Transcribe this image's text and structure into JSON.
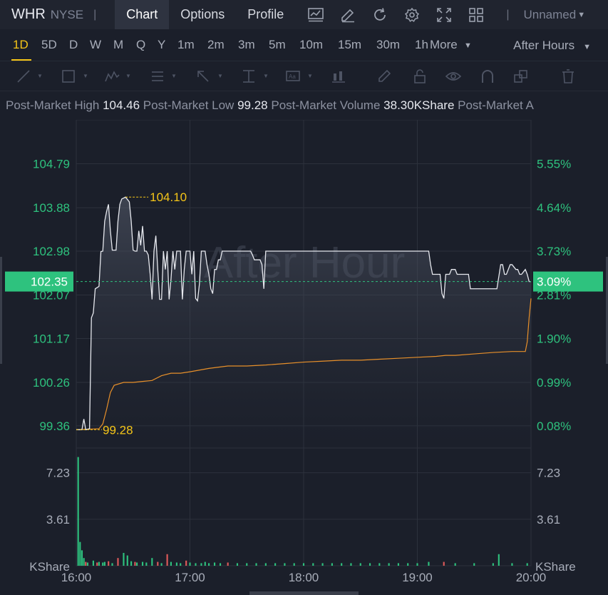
{
  "header": {
    "ticker": "WHR",
    "exchange": "NYSE",
    "separator": "|",
    "tabs": [
      "Chart",
      "Options",
      "Profile"
    ],
    "layout_name": "Unnamed"
  },
  "periods": {
    "items": [
      "1D",
      "5D",
      "D",
      "W",
      "M",
      "Q",
      "Y",
      "1m",
      "2m",
      "3m",
      "5m",
      "10m",
      "15m",
      "30m",
      "1h"
    ],
    "more": "More",
    "session": "After Hours"
  },
  "info": {
    "high_label": "Post-Market High",
    "high_value": "104.46",
    "low_label": "Post-Market Low",
    "low_value": "99.28",
    "volume_label": "Post-Market Volume",
    "volume_value": "38.30KShare",
    "extra_label": "Post-Market A"
  },
  "colors": {
    "up": "#2ec27e",
    "down": "#e05a5a",
    "avg_line": "#e8902a",
    "price_line": "#e6e8ee",
    "highlight": "#f5c518"
  },
  "chart_data": {
    "type": "line",
    "watermark": "After Hour",
    "x_ticks": [
      "16:00",
      "17:00",
      "18:00",
      "19:00",
      "20:00"
    ],
    "y_ticks": [
      "104.79",
      "103.88",
      "102.98",
      "102.07",
      "101.17",
      "100.26",
      "99.36"
    ],
    "pct_ticks": [
      "5.55%",
      "4.64%",
      "3.73%",
      "2.81%",
      "1.90%",
      "0.99%",
      "0.08%"
    ],
    "ylim": [
      98.9,
      105.7
    ],
    "current_price": "102.35",
    "current_pct": "3.09%",
    "max_label": "104.10",
    "min_label": "99.28",
    "volume_ticks": [
      "7.23",
      "3.61"
    ],
    "volume_unit": "KShare",
    "volume_ylim": [
      0,
      9.15
    ],
    "price_series": [
      [
        0,
        99.28
      ],
      [
        3,
        99.28
      ],
      [
        4,
        99.5
      ],
      [
        5,
        99.28
      ],
      [
        7,
        99.3
      ],
      [
        8,
        101.6
      ],
      [
        9,
        101.7
      ],
      [
        10,
        102.2
      ],
      [
        12,
        102.25
      ],
      [
        13,
        102.97
      ],
      [
        14,
        102.98
      ],
      [
        15,
        103.6
      ],
      [
        16,
        103.8
      ],
      [
        17,
        103.95
      ],
      [
        18,
        103.4
      ],
      [
        19,
        103.0
      ],
      [
        21,
        103.0
      ],
      [
        22,
        103.6
      ],
      [
        23,
        103.95
      ],
      [
        24,
        104.06
      ],
      [
        26,
        104.1
      ],
      [
        28,
        104.0
      ],
      [
        29,
        103.6
      ],
      [
        30,
        103.0
      ],
      [
        31,
        102.98
      ],
      [
        32,
        102.98
      ],
      [
        33,
        103.4
      ],
      [
        34,
        103.1
      ],
      [
        35,
        103.5
      ],
      [
        36,
        102.98
      ],
      [
        37,
        102.98
      ],
      [
        38,
        102.9
      ],
      [
        39,
        102.5
      ],
      [
        40,
        101.98
      ],
      [
        41,
        102.98
      ],
      [
        42,
        103.3
      ],
      [
        43,
        102.6
      ],
      [
        44,
        101.98
      ],
      [
        45,
        101.98
      ],
      [
        46,
        102.98
      ],
      [
        47,
        102.6
      ],
      [
        48,
        102.98
      ],
      [
        49,
        101.98
      ],
      [
        50,
        102.4
      ],
      [
        51,
        102.98
      ],
      [
        52,
        102.6
      ],
      [
        53,
        102.98
      ],
      [
        55,
        102.98
      ],
      [
        56,
        101.98
      ],
      [
        57,
        102.6
      ],
      [
        58,
        102.98
      ],
      [
        59,
        102.98
      ],
      [
        60,
        102.98
      ],
      [
        61,
        102.5
      ],
      [
        62,
        102.98
      ],
      [
        63,
        102.0
      ],
      [
        64,
        101.95
      ],
      [
        65,
        102.3
      ],
      [
        66,
        102.98
      ],
      [
        67,
        102.98
      ],
      [
        68,
        102.98
      ],
      [
        69,
        102.7
      ],
      [
        70,
        102.5
      ],
      [
        71,
        102.2
      ],
      [
        72,
        102.1
      ],
      [
        73,
        102.6
      ],
      [
        74,
        102.6
      ],
      [
        75,
        102.8
      ],
      [
        76,
        102.8
      ],
      [
        77,
        102.98
      ],
      [
        79,
        102.98
      ],
      [
        80,
        102.98
      ],
      [
        81,
        102.98
      ],
      [
        83,
        102.98
      ],
      [
        85,
        102.98
      ],
      [
        89,
        102.98
      ],
      [
        90,
        102.98
      ],
      [
        92,
        102.98
      ],
      [
        93,
        102.9
      ],
      [
        94,
        102.8
      ],
      [
        95,
        102.8
      ],
      [
        97,
        102.8
      ],
      [
        98,
        102.7
      ],
      [
        99,
        102.2
      ],
      [
        100,
        102.98
      ],
      [
        102,
        102.98
      ],
      [
        105,
        102.98
      ],
      [
        108,
        102.98
      ],
      [
        110,
        102.98
      ],
      [
        115,
        102.98
      ],
      [
        120,
        102.98
      ],
      [
        125,
        102.98
      ],
      [
        130,
        102.98
      ],
      [
        135,
        102.98
      ],
      [
        140,
        102.98
      ],
      [
        145,
        102.98
      ],
      [
        150,
        102.98
      ],
      [
        155,
        102.98
      ],
      [
        160,
        102.98
      ],
      [
        165,
        102.98
      ],
      [
        170,
        102.98
      ],
      [
        175,
        102.98
      ],
      [
        180,
        102.98
      ],
      [
        185,
        102.98
      ],
      [
        186,
        102.98
      ],
      [
        187,
        102.7
      ],
      [
        188,
        102.5
      ],
      [
        190,
        102.5
      ],
      [
        192,
        102.5
      ],
      [
        193,
        102.1
      ],
      [
        194,
        102.0
      ],
      [
        195,
        102.5
      ],
      [
        196,
        102.5
      ],
      [
        197,
        102.5
      ],
      [
        198,
        102.6
      ],
      [
        199,
        102.6
      ],
      [
        200,
        102.6
      ],
      [
        201,
        102.5
      ],
      [
        202,
        102.5
      ],
      [
        203,
        102.5
      ],
      [
        204,
        102.5
      ],
      [
        205,
        102.5
      ],
      [
        207,
        102.5
      ],
      [
        208,
        102.2
      ],
      [
        210,
        102.2
      ],
      [
        212,
        102.2
      ],
      [
        214,
        102.2
      ],
      [
        216,
        102.2
      ],
      [
        218,
        102.2
      ],
      [
        220,
        102.2
      ],
      [
        222,
        102.2
      ],
      [
        224,
        102.7
      ],
      [
        225,
        102.7
      ],
      [
        226,
        102.5
      ],
      [
        227,
        102.5
      ],
      [
        229,
        102.7
      ],
      [
        230,
        102.7
      ],
      [
        231,
        102.65
      ],
      [
        232,
        102.6
      ],
      [
        233,
        102.6
      ],
      [
        234,
        102.5
      ],
      [
        235,
        102.5
      ],
      [
        236,
        102.55
      ],
      [
        237,
        102.6
      ],
      [
        238,
        102.5
      ],
      [
        239,
        102.35
      ],
      [
        240,
        102.35
      ]
    ],
    "avg_series": [
      [
        0,
        99.28
      ],
      [
        12,
        99.3
      ],
      [
        14,
        99.4
      ],
      [
        16,
        99.7
      ],
      [
        18,
        100.05
      ],
      [
        20,
        100.2
      ],
      [
        25,
        100.26
      ],
      [
        30,
        100.26
      ],
      [
        35,
        100.28
      ],
      [
        40,
        100.3
      ],
      [
        45,
        100.4
      ],
      [
        50,
        100.45
      ],
      [
        55,
        100.45
      ],
      [
        60,
        100.48
      ],
      [
        70,
        100.55
      ],
      [
        80,
        100.6
      ],
      [
        90,
        100.6
      ],
      [
        100,
        100.62
      ],
      [
        110,
        100.65
      ],
      [
        120,
        100.68
      ],
      [
        130,
        100.7
      ],
      [
        140,
        100.72
      ],
      [
        150,
        100.72
      ],
      [
        160,
        100.74
      ],
      [
        170,
        100.76
      ],
      [
        180,
        100.78
      ],
      [
        190,
        100.8
      ],
      [
        195,
        100.82
      ],
      [
        200,
        100.82
      ],
      [
        210,
        100.85
      ],
      [
        220,
        100.88
      ],
      [
        230,
        100.9
      ],
      [
        235,
        100.9
      ],
      [
        237,
        100.9
      ],
      [
        238,
        101.1
      ],
      [
        239,
        101.6
      ],
      [
        240,
        102.0
      ]
    ],
    "volume_bars": [
      {
        "t": 1,
        "v": 8.45,
        "dir": "up"
      },
      {
        "t": 2,
        "v": 1.85,
        "dir": "up"
      },
      {
        "t": 3,
        "v": 1.2,
        "dir": "up"
      },
      {
        "t": 4,
        "v": 0.6,
        "dir": "up"
      },
      {
        "t": 5,
        "v": 0.3,
        "dir": "down"
      },
      {
        "t": 6,
        "v": 0.25,
        "dir": "up"
      },
      {
        "t": 9,
        "v": 0.4,
        "dir": "up"
      },
      {
        "t": 11,
        "v": 0.25,
        "dir": "down"
      },
      {
        "t": 12,
        "v": 0.3,
        "dir": "up"
      },
      {
        "t": 14,
        "v": 0.25,
        "dir": "up"
      },
      {
        "t": 15,
        "v": 0.3,
        "dir": "up"
      },
      {
        "t": 17,
        "v": 0.35,
        "dir": "down"
      },
      {
        "t": 19,
        "v": 0.2,
        "dir": "up"
      },
      {
        "t": 22,
        "v": 0.6,
        "dir": "down"
      },
      {
        "t": 25,
        "v": 1.0,
        "dir": "up"
      },
      {
        "t": 27,
        "v": 0.8,
        "dir": "up"
      },
      {
        "t": 29,
        "v": 0.35,
        "dir": "up"
      },
      {
        "t": 31,
        "v": 0.3,
        "dir": "down"
      },
      {
        "t": 32,
        "v": 0.25,
        "dir": "up"
      },
      {
        "t": 35,
        "v": 0.3,
        "dir": "up"
      },
      {
        "t": 37,
        "v": 0.25,
        "dir": "up"
      },
      {
        "t": 40,
        "v": 0.6,
        "dir": "up"
      },
      {
        "t": 43,
        "v": 0.3,
        "dir": "down"
      },
      {
        "t": 45,
        "v": 0.2,
        "dir": "up"
      },
      {
        "t": 48,
        "v": 0.9,
        "dir": "down"
      },
      {
        "t": 50,
        "v": 0.3,
        "dir": "up"
      },
      {
        "t": 53,
        "v": 0.25,
        "dir": "up"
      },
      {
        "t": 55,
        "v": 0.2,
        "dir": "up"
      },
      {
        "t": 58,
        "v": 0.4,
        "dir": "down"
      },
      {
        "t": 60,
        "v": 0.25,
        "dir": "up"
      },
      {
        "t": 63,
        "v": 0.2,
        "dir": "up"
      },
      {
        "t": 66,
        "v": 0.2,
        "dir": "up"
      },
      {
        "t": 68,
        "v": 0.3,
        "dir": "up"
      },
      {
        "t": 70,
        "v": 0.2,
        "dir": "up"
      },
      {
        "t": 73,
        "v": 0.25,
        "dir": "up"
      },
      {
        "t": 76,
        "v": 0.2,
        "dir": "up"
      },
      {
        "t": 80,
        "v": 0.25,
        "dir": "down"
      },
      {
        "t": 85,
        "v": 0.2,
        "dir": "up"
      },
      {
        "t": 90,
        "v": 0.2,
        "dir": "up"
      },
      {
        "t": 95,
        "v": 0.2,
        "dir": "up"
      },
      {
        "t": 100,
        "v": 0.2,
        "dir": "up"
      },
      {
        "t": 105,
        "v": 0.2,
        "dir": "up"
      },
      {
        "t": 110,
        "v": 0.2,
        "dir": "up"
      },
      {
        "t": 115,
        "v": 0.2,
        "dir": "up"
      },
      {
        "t": 120,
        "v": 0.2,
        "dir": "up"
      },
      {
        "t": 125,
        "v": 0.2,
        "dir": "up"
      },
      {
        "t": 130,
        "v": 0.2,
        "dir": "up"
      },
      {
        "t": 135,
        "v": 0.2,
        "dir": "up"
      },
      {
        "t": 140,
        "v": 0.2,
        "dir": "up"
      },
      {
        "t": 145,
        "v": 0.2,
        "dir": "up"
      },
      {
        "t": 150,
        "v": 0.2,
        "dir": "up"
      },
      {
        "t": 155,
        "v": 0.2,
        "dir": "up"
      },
      {
        "t": 160,
        "v": 0.2,
        "dir": "up"
      },
      {
        "t": 165,
        "v": 0.2,
        "dir": "up"
      },
      {
        "t": 170,
        "v": 0.2,
        "dir": "up"
      },
      {
        "t": 175,
        "v": 0.2,
        "dir": "up"
      },
      {
        "t": 180,
        "v": 0.2,
        "dir": "up"
      },
      {
        "t": 186,
        "v": 0.3,
        "dir": "up"
      },
      {
        "t": 194,
        "v": 0.3,
        "dir": "down"
      },
      {
        "t": 200,
        "v": 0.2,
        "dir": "up"
      },
      {
        "t": 210,
        "v": 0.2,
        "dir": "up"
      },
      {
        "t": 220,
        "v": 0.2,
        "dir": "up"
      },
      {
        "t": 223,
        "v": 0.9,
        "dir": "up"
      },
      {
        "t": 230,
        "v": 0.2,
        "dir": "up"
      },
      {
        "t": 238,
        "v": 0.2,
        "dir": "up"
      }
    ]
  }
}
